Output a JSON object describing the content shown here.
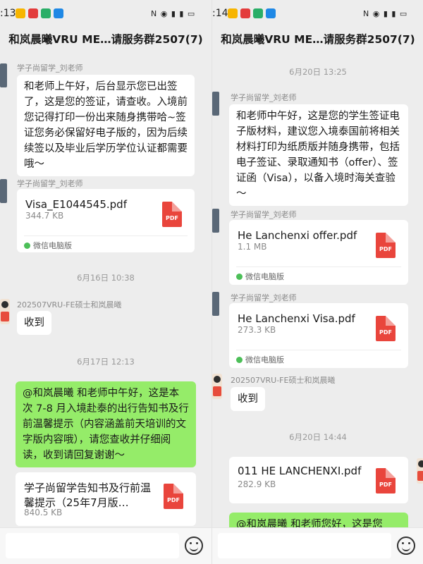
{
  "left": {
    "status": {
      "time": ":13"
    },
    "title": "和岚晨曦VRU ME…请服务群2507(7)",
    "messages": {
      "m1": {
        "sender": "学子尚留学_刘老师",
        "text": "和老师上午好，后台显示您已出签了，这是您的签证，请查收。入境前您记得打印一份出来随身携带哈~签证您务必保留好电子版的，因为后续续签以及毕业后学历学位认证都需要哦～"
      },
      "m2": {
        "sender": "学子尚留学_刘老师",
        "file": "Visa_E1044545.pdf",
        "size": "344.7 KB",
        "source": "微信电脑版",
        "icon": "PDF"
      },
      "t1": "6月16日 10:38",
      "m3": {
        "sender": "202507VRU-FE硕士和岚晨曦",
        "text": "收到"
      },
      "t2": "6月17日 12:13",
      "m4": {
        "text": "@和岚晨曦 和老师中午好，这是本次 7-8 月入境赴泰的出行告知书及行前温馨提示（内容涵盖前天培训的文字版内容哦），请您查收并仔细阅读，收到请回复谢谢～"
      },
      "m5": {
        "file": "学子尚留学告知书及行前温馨提示（25年7月版…",
        "size": "840.5 KB",
        "icon": "PDF"
      }
    }
  },
  "right": {
    "status": {
      "time": ":14"
    },
    "title": "和岚晨曦VRU ME…请服务群2507(7)",
    "messages": {
      "t1": "6月20日 13:25",
      "m1": {
        "sender": "学子尚留学_刘老师",
        "text": "和老师中午好，这是您的学生签证电子版材料，建议您入境泰国前将相关材料打印为纸质版并随身携带，包括电子签证、录取通知书（offer）、签证函（Visa），以备入境时海关查验～"
      },
      "m2": {
        "sender": "学子尚留学_刘老师",
        "file": "He Lanchenxi offer.pdf",
        "size": "1.1 MB",
        "source": "微信电脑版",
        "icon": "PDF"
      },
      "m3": {
        "sender": "学子尚留学_刘老师",
        "file": "He Lanchenxi Visa.pdf",
        "size": "273.3 KB",
        "source": "微信电脑版",
        "icon": "PDF"
      },
      "m4": {
        "sender": "202507VRU-FE硕士和岚晨曦",
        "text": "收到"
      },
      "t2": "6月20日 14:44",
      "m5": {
        "file": "011 HE LANCHENXI.pdf",
        "size": "282.9 KB",
        "icon": "PDF"
      },
      "m6": {
        "text": "@和岚晨曦 和老师您好，这是您"
      }
    }
  },
  "icons": [
    "wechat-icon",
    "emoji-icon",
    "pdf-icon",
    "avatar-icon"
  ],
  "colors": {
    "self_bubble": "#95ec69",
    "pdf": "#e9453c",
    "background": "#ededed"
  }
}
